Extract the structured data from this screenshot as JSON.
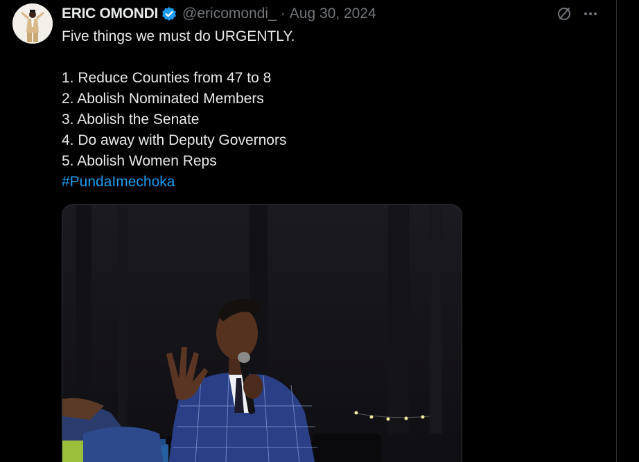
{
  "author": {
    "display_name": "ERIC OMONDI",
    "handle": "@ericomondi_",
    "separator": "·",
    "date": "Aug 30, 2024",
    "verified": true,
    "verified_color": "#1d9bf0"
  },
  "actions": {
    "grok_icon": "slash-circle-icon",
    "more_icon": "more-horizontal-icon"
  },
  "tweet": {
    "lines": [
      "Five things we must do URGENTLY.",
      "",
      "1. Reduce Counties from 47 to 8",
      "2. Abolish Nominated Members",
      "3. Abolish the Senate",
      "4. Do away with Deputy Governors",
      "5. Abolish Women Reps"
    ],
    "hashtag": "#PundaImechoka",
    "hashtag_color": "#1d9bf0"
  },
  "media": {
    "type": "photo"
  }
}
